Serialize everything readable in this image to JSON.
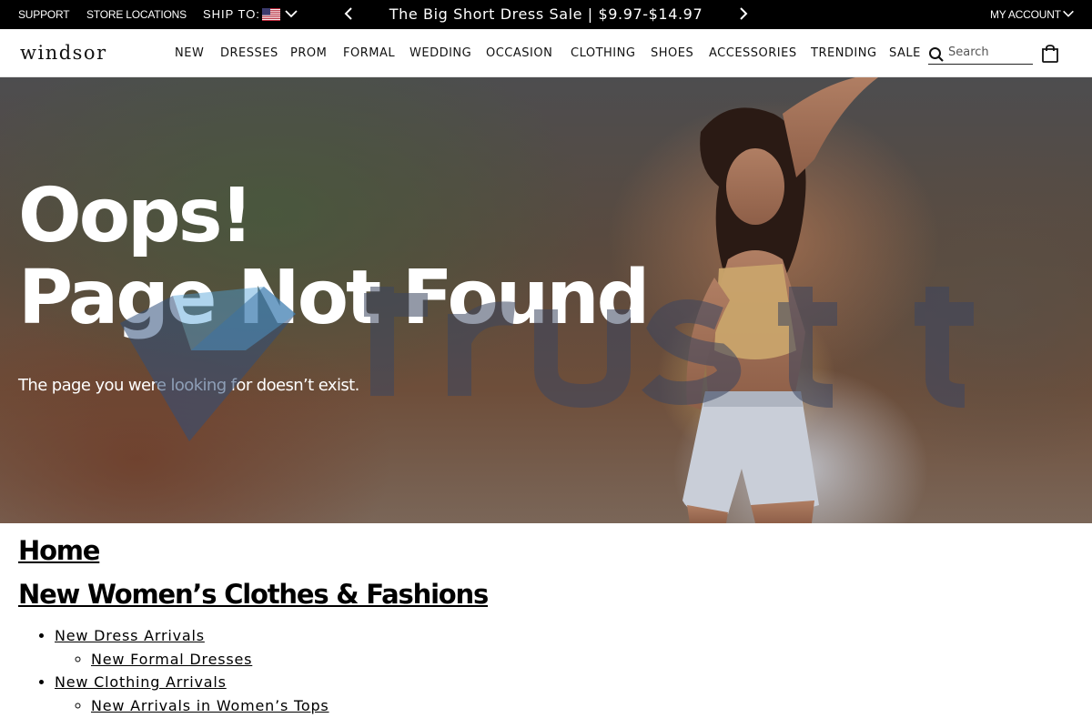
{
  "topbar": {
    "support": "SUPPORT",
    "store_locations": "STORE LOCATIONS",
    "ship_to": "SHIP TO:",
    "flag_icon": "us-flag-icon",
    "promo": "The Big Short Dress Sale | $9.97-$14.97",
    "my_account": "MY ACCOUNT"
  },
  "header": {
    "logo": "windsor",
    "nav": [
      "NEW",
      "DRESSES",
      "PROM",
      "FORMAL",
      "WEDDING",
      "OCCASION",
      "CLOTHING",
      "SHOES",
      "ACCESSORIES",
      "TRENDING",
      "SALE"
    ],
    "search_placeholder": "Search"
  },
  "hero": {
    "title_line1": "Oops!",
    "title_line2": "Page Not Found",
    "subtitle": "The page you were looking for doesn’t exist."
  },
  "sitemap": {
    "home": "Home",
    "section_title": "New Women’s Clothes & Fashions",
    "items": [
      {
        "label": "New Dress Arrivals",
        "children": [
          "New Formal Dresses"
        ]
      },
      {
        "label": "New Clothing Arrivals",
        "children": [
          "New Arrivals in Women’s Tops"
        ]
      }
    ]
  },
  "colors": {
    "topbar_bg": "#000000",
    "text": "#000000",
    "hero_text": "#ffffff"
  }
}
